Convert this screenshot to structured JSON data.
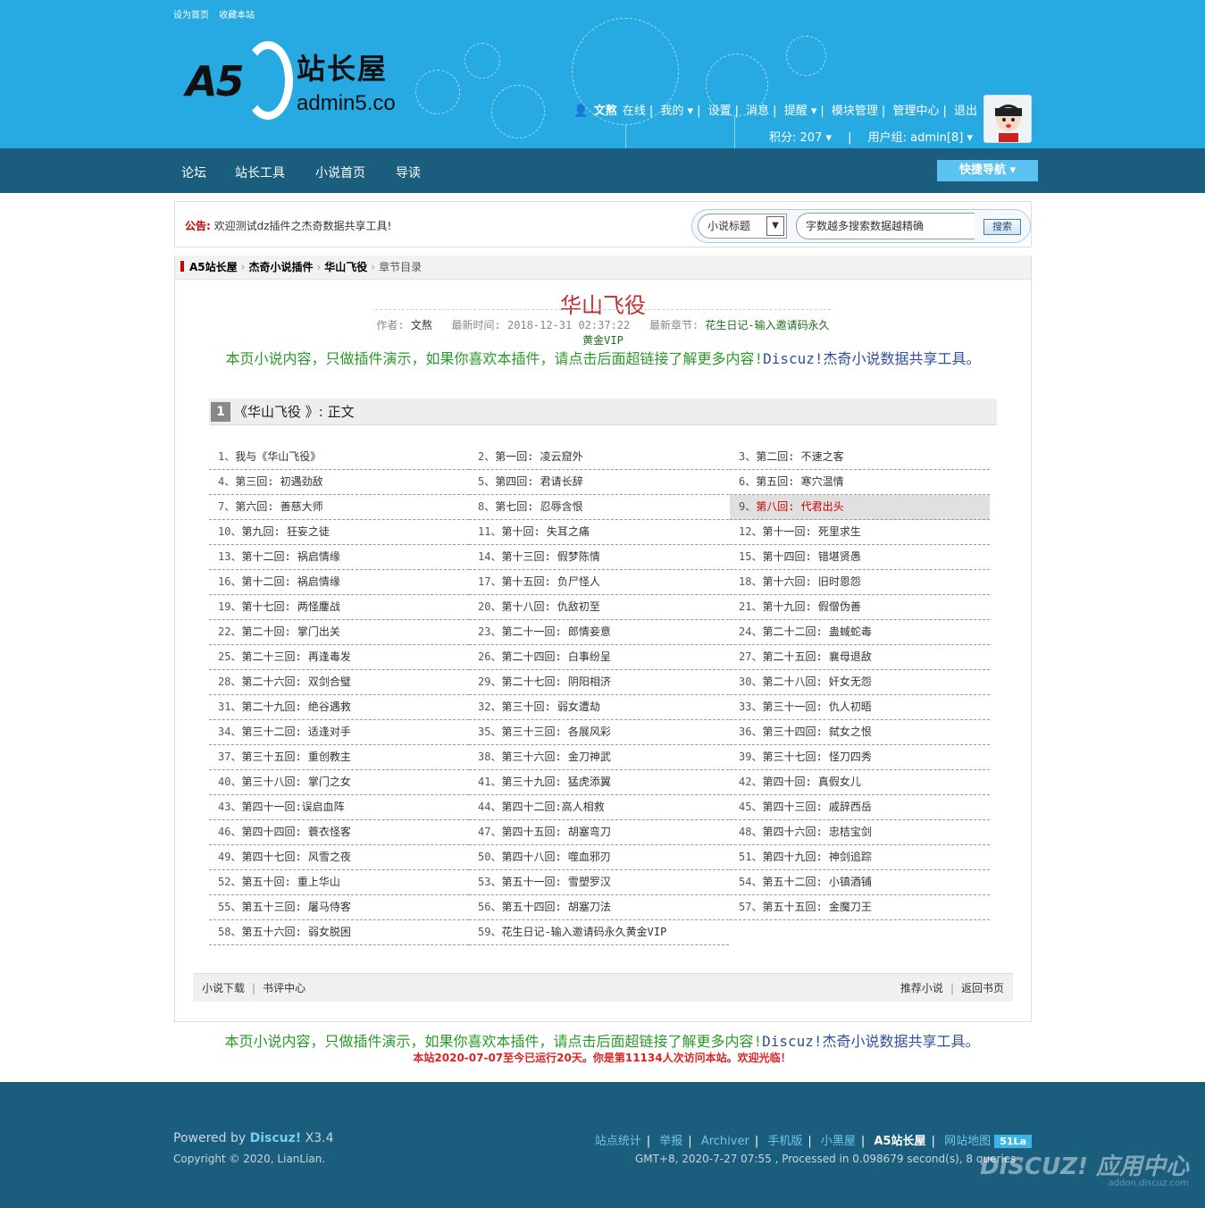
{
  "toplinks": [
    "设为首页",
    "收藏本站"
  ],
  "logo": {
    "mark": "A5",
    "cn": "站长屋",
    "en": "admin5.co"
  },
  "usernav": {
    "items": [
      "文熬",
      "在线",
      "我的 ▾",
      "设置",
      "消息",
      "提醒 ▾",
      "模块管理",
      "管理中心",
      "退出"
    ],
    "credits": "积分: 207 ▾",
    "group": "用户组: admin[8] ▾"
  },
  "nav": {
    "items": [
      "论坛",
      "站长工具",
      "小说首页",
      "导读"
    ],
    "quick": "快捷导航 ▾"
  },
  "notice": {
    "label": "公告:",
    "text": "欢迎测试dz插件之杰奇数据共享工具!"
  },
  "search": {
    "select": "小说标题",
    "placeholder": "字数越多搜索数据越精确",
    "button": "搜索"
  },
  "breadcrumb": {
    "home": "A5站长屋",
    "plugin": "杰奇小说插件",
    "book": "华山飞役",
    "current": "章节目录"
  },
  "book": {
    "title": "华山飞役",
    "author_label": "作者:",
    "author": "文熬",
    "updated_label": "最新时间:",
    "updated": "2018-12-31 02:37:22",
    "latest_label": "最新章节:",
    "latest": "花生日记-输入邀请码永久黄金VIP"
  },
  "promo": {
    "green": "本页小说内容，只做插件演示，如果你喜欢本插件，请点击后面超链接了解更多内容!",
    "blue": "Discuz!杰奇小说数据共享工具。"
  },
  "volume": {
    "num": "1",
    "title": "《华山飞役 》: 正文"
  },
  "chapters": [
    "我与《华山飞役》",
    "第一回: 凌云窟外",
    "第二回: 不速之客",
    "第三回: 初遇劲敌",
    "第四回: 君请长辞",
    "第五回: 寒穴温情",
    "第六回: 善慈大师",
    "第七回: 忍辱含恨",
    "第八回: 代君出头",
    "第九回: 狂妄之徒",
    "第十回: 失耳之痛",
    "第十一回: 死里求生",
    "第十二回: 祸启情缘",
    "第十三回: 假梦陈情",
    "第十四回: 错堪贤愚",
    "第十二回: 祸启情缘",
    "第十五回: 负尸怪人",
    "第十六回: 旧时恩怨",
    "第十七回: 两怪鏖战",
    "第十八回: 仇敌初至",
    "第十九回: 假僧伪善",
    "第二十回: 掌门出关",
    "第二十一回: 郎情妾意",
    "第二十二回: 蛊蜮蛇毒",
    "第二十三回: 再逢毒发",
    "第二十四回: 白事纷呈",
    "第二十五回: 襄母退敌",
    "第二十六回: 双剑合璧",
    "第二十七回: 阴阳相济",
    "第二十八回: 奸女无怨",
    "第二十九回: 绝谷遇救",
    "第三十回: 弱女遭劫",
    "第三十一回: 仇人初晤",
    "第三十二回: 适逢对手",
    "第三十三回: 各展风彩",
    "第三十四回: 弑女之恨",
    "第三十五回: 重创教主",
    "第三十六回: 金刀神武",
    "第三十七回: 怪刀四秀",
    "第三十八回: 掌门之女",
    "第三十九回: 猛虎添翼",
    "第四十回: 真假女儿",
    "第四十一回:误启血阵",
    "第四十二回:高人相救",
    "第四十三回: 戚辞西岳",
    "第四十四回: 蓑衣怪客",
    "第四十五回: 胡塞弯刀",
    "第四十六回: 忠桔宝剑",
    "第四十七回: 风雪之夜",
    "第四十八回: 噬血邪刃",
    "第四十九回: 神剑追踪",
    "第五十回: 重上华山",
    "第五十一回: 雪塑罗汉",
    "第五十二回: 小镇酒铺",
    "第五十三回: 屠马侍客",
    "第五十四回: 胡塞刀法",
    "第五十五回: 金魔刀王",
    "第五十六回: 弱女脱困",
    "花生日记-输入邀请码永久黄金VIP"
  ],
  "highlight_index": 9,
  "bottom_links": {
    "left": [
      "小说下载",
      "书评中心"
    ],
    "right": [
      "推荐小说",
      "返回书页"
    ]
  },
  "run_line": "本站2020-07-07至今已运行20天。你是第11134人次访问本站。欢迎光临！",
  "footer": {
    "powered_prefix": "Powered by",
    "powered_brand": "Discuz!",
    "powered_ver": "X3.4",
    "copyright": "Copyright © 2020, LianLian.",
    "links": [
      "站点统计",
      "举报",
      "Archiver",
      "手机版",
      "小黑屋",
      "A5站长屋",
      "网站地图"
    ],
    "badge": "51La",
    "stat": "GMT+8, 2020-7-27 07:55 , Processed in 0.098679 second(s), 8 queries .",
    "watermark": "DISCUZ! 应用中心",
    "watermark_url": "addon.discuz.com"
  }
}
